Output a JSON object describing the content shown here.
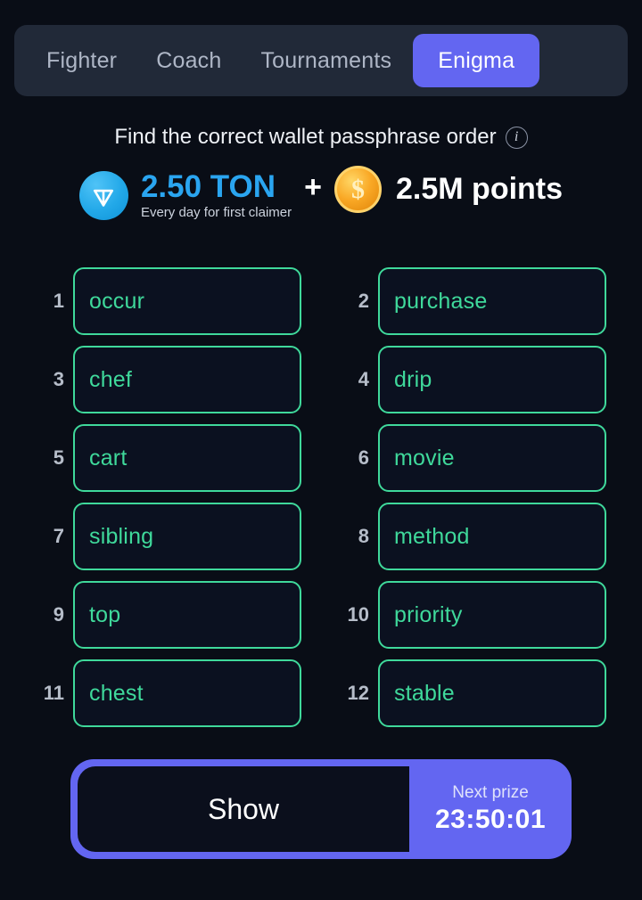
{
  "theme": {
    "background": "#090d16",
    "accent_purple": "#6366f1",
    "accent_green": "#3fd99b",
    "ton_blue": "#2aa5f0",
    "coin_gold": "#f9a825"
  },
  "tabs": [
    {
      "label": "Fighter",
      "active": false
    },
    {
      "label": "Coach",
      "active": false
    },
    {
      "label": "Tournaments",
      "active": false
    },
    {
      "label": "Enigma",
      "active": true
    }
  ],
  "header": {
    "title": "Find the correct wallet passphrase order",
    "info_icon": "info-icon"
  },
  "prize": {
    "ton_icon": "ton-logo-icon",
    "ton_amount": "2.50 TON",
    "ton_subtitle": "Every day for first claimer",
    "separator": "+",
    "coin_icon": "gold-coin-icon",
    "coin_symbol": "$",
    "points_amount": "2.5M points"
  },
  "grid": {
    "words": [
      {
        "index": "1",
        "word": "occur"
      },
      {
        "index": "2",
        "word": "purchase"
      },
      {
        "index": "3",
        "word": "chef"
      },
      {
        "index": "4",
        "word": "drip"
      },
      {
        "index": "5",
        "word": "cart"
      },
      {
        "index": "6",
        "word": "movie"
      },
      {
        "index": "7",
        "word": "sibling"
      },
      {
        "index": "8",
        "word": "method"
      },
      {
        "index": "9",
        "word": "top"
      },
      {
        "index": "10",
        "word": "priority"
      },
      {
        "index": "11",
        "word": "chest"
      },
      {
        "index": "12",
        "word": "stable"
      }
    ]
  },
  "bottom": {
    "show_label": "Show",
    "next_prize_label": "Next prize",
    "next_prize_time": "23:50:01"
  }
}
